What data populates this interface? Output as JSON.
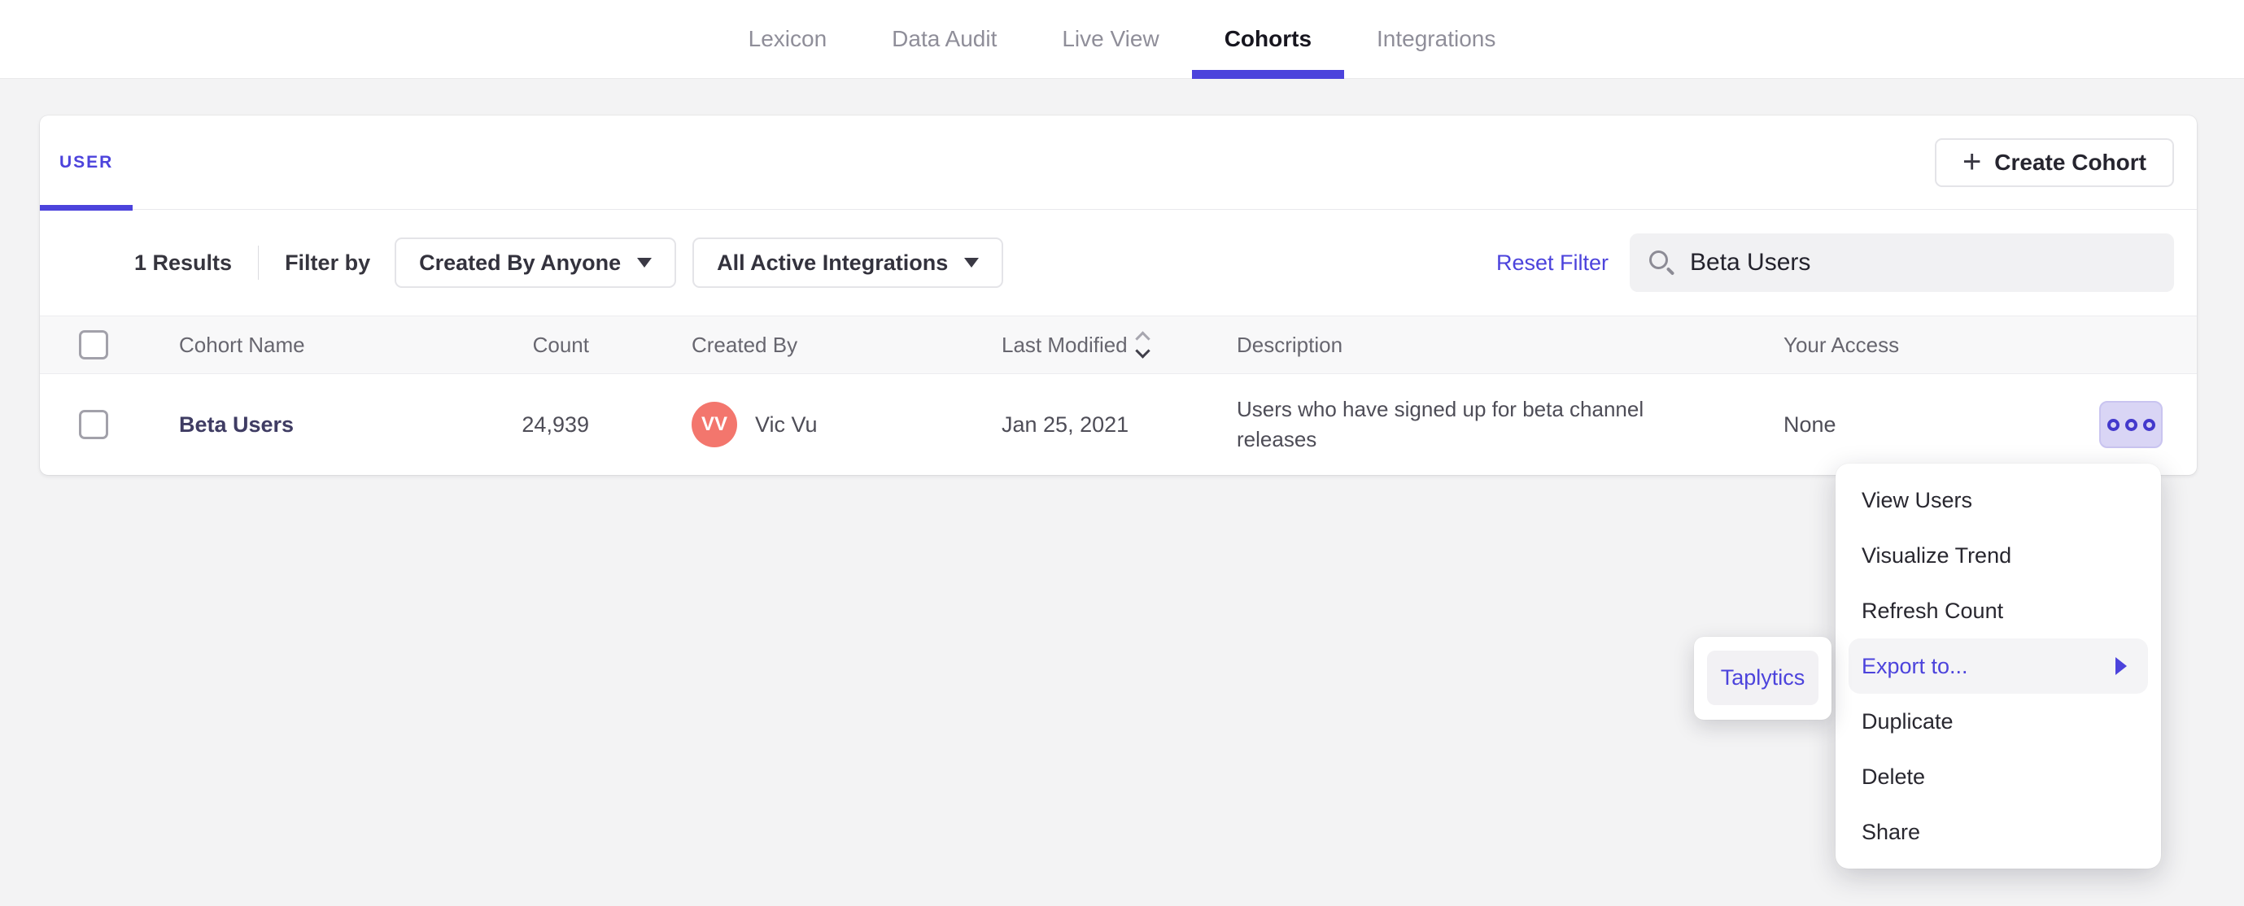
{
  "colors": {
    "accent": "#4C43DC",
    "avatar_bg": "#F3766D",
    "actions_bg": "#D9D5F5"
  },
  "nav": {
    "items": [
      {
        "label": "Lexicon"
      },
      {
        "label": "Data Audit"
      },
      {
        "label": "Live View"
      },
      {
        "label": "Cohorts"
      },
      {
        "label": "Integrations"
      }
    ]
  },
  "card": {
    "tab_label": "USER",
    "create_button_label": "Create Cohort",
    "filters": {
      "results_count": "1 Results",
      "filter_by_label": "Filter by",
      "created_by_dropdown": "Created By Anyone",
      "integrations_dropdown": "All Active Integrations",
      "reset_filter_label": "Reset Filter",
      "search_value": "Beta Users"
    },
    "table": {
      "headers": {
        "name": "Cohort Name",
        "count": "Count",
        "created_by": "Created By",
        "last_modified": "Last Modified",
        "description": "Description",
        "access": "Your Access"
      },
      "row": {
        "name": "Beta Users",
        "count": "24,939",
        "avatar_initials": "VV",
        "created_by": "Vic Vu",
        "last_modified": "Jan 25, 2021",
        "description": "Users who have signed up for beta channel releases",
        "access": "None"
      }
    }
  },
  "context_menu": {
    "items": [
      "View Users",
      "Visualize Trend",
      "Refresh Count",
      "Export to...",
      "Duplicate",
      "Delete",
      "Share"
    ]
  },
  "export_submenu": {
    "items": [
      "Taplytics"
    ]
  },
  "icons": [
    "plus-icon",
    "caret-down-icon",
    "search-icon",
    "sort-icon",
    "ellipsis-icon",
    "submenu-arrow-icon",
    "checkbox"
  ]
}
